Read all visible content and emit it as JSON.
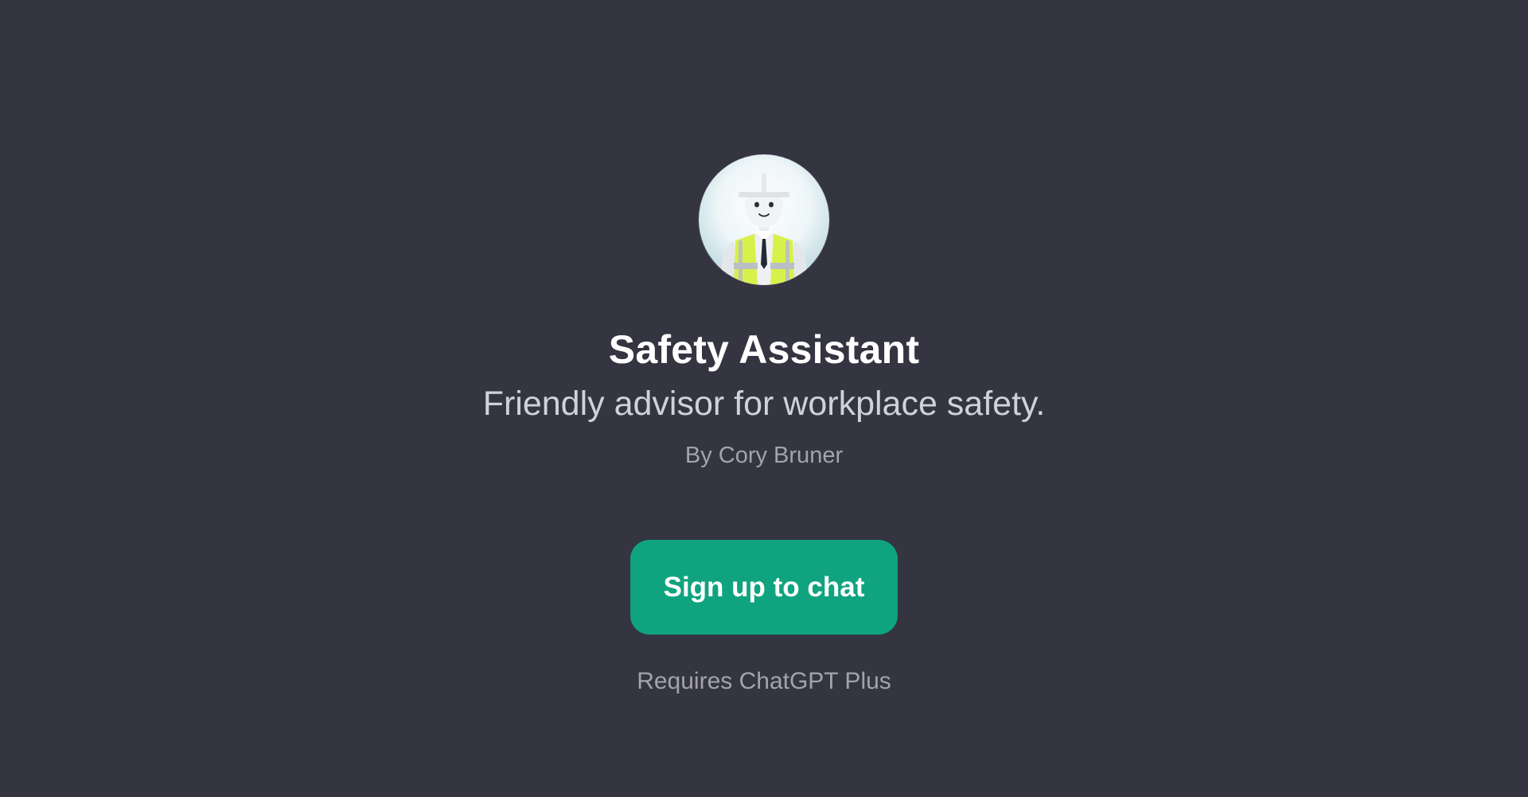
{
  "gpt": {
    "name": "Safety Assistant",
    "description": "Friendly advisor for workplace safety.",
    "author": "By Cory Bruner",
    "avatar_icon": "safety-worker-avatar"
  },
  "actions": {
    "signup_label": "Sign up to chat",
    "requirement": "Requires ChatGPT Plus"
  },
  "colors": {
    "background": "#343541",
    "accent": "#10a37f",
    "title": "#ffffff",
    "muted": "#a3a3ad"
  }
}
